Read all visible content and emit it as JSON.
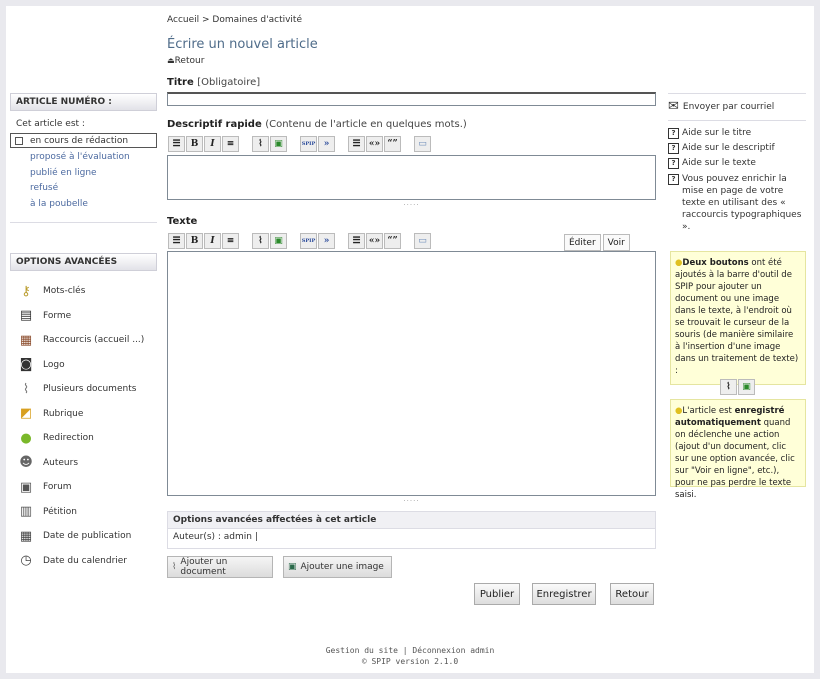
{
  "breadcrumb": {
    "home": "Accueil",
    "sep": " > ",
    "section": "Domaines d'activité"
  },
  "page_title": "Écrire un nouvel article",
  "back_link": "Retour",
  "article_box": {
    "heading": "ARTICLE NUMÉRO :",
    "status_label": "Cet article est :",
    "current_status": "en cours de rédaction",
    "statuses": [
      "proposé à l'évaluation",
      "publié en ligne",
      "refusé",
      "à la poubelle"
    ]
  },
  "advanced": {
    "heading": "OPTIONS AVANCÉES",
    "items": [
      {
        "label": "Mots-clés",
        "icon": "key-icon"
      },
      {
        "label": "Forme",
        "icon": "form-icon"
      },
      {
        "label": "Raccourcis (accueil ...)",
        "icon": "shortcuts-icon"
      },
      {
        "label": "Logo",
        "icon": "camera-icon"
      },
      {
        "label": "Plusieurs documents",
        "icon": "paperclip-icon"
      },
      {
        "label": "Rubrique",
        "icon": "folder-icon"
      },
      {
        "label": "Redirection",
        "icon": "globe-icon"
      },
      {
        "label": "Auteurs",
        "icon": "user-icon"
      },
      {
        "label": "Forum",
        "icon": "forum-icon"
      },
      {
        "label": "Pétition",
        "icon": "petition-icon"
      },
      {
        "label": "Date de publication",
        "icon": "calendar-icon"
      },
      {
        "label": "Date du calendrier",
        "icon": "calendar-clock-icon"
      }
    ]
  },
  "form": {
    "titre_label": "Titre",
    "titre_hint": "[Obligatoire]",
    "titre_value": "",
    "descriptif_label": "Descriptif rapide",
    "descriptif_hint": "(Contenu de l'article en quelques mots.)",
    "texte_label": "Texte",
    "tab_edit": "Éditer",
    "tab_view": "Voir",
    "toolbar": {
      "bold": "B",
      "italic": "I",
      "spip": "SPIP",
      "quote_fr": "«»",
      "quote_en": "“”"
    },
    "grip": "....."
  },
  "options_panel": {
    "heading": "Options avancées affectées à cet article",
    "authors": "Auteur(s) : admin |"
  },
  "attach": {
    "doc": "Ajouter un document",
    "image": "Ajouter une image"
  },
  "buttons": {
    "publish": "Publier",
    "save": "Enregistrer",
    "back": "Retour"
  },
  "right": {
    "email": "Envoyer par courriel",
    "help_title": "Aide sur le titre",
    "help_desc": "Aide sur le descriptif",
    "help_text": "Aide sur le texte",
    "help_shortcuts": "Vous pouvez enrichir la mise en page de votre texte en utilisant des « raccourcis typographiques ».",
    "tip1_bold": "Deux boutons",
    "tip1_rest": " ont été ajoutés à la barre d'outil de SPIP pour ajouter un document ou une image dans le texte, à l'endroit où se trouvait le curseur de la souris (de manière similaire à l'insertion d'une image dans un traitement de texte) :",
    "tip2_pre": "L'article est ",
    "tip2_bold": "enregistré automatiquement",
    "tip2_rest": " quand on déclenche une action (ajout d'un document, clic sur une option avancée, clic sur \"Voir en ligne\", etc.), pour ne pas perdre le texte saisi."
  },
  "footer": {
    "line1a": "Gestion du site",
    "sep": " | ",
    "line1b": "Déconnexion admin",
    "line2": "© SPIP version 2.1.0"
  }
}
